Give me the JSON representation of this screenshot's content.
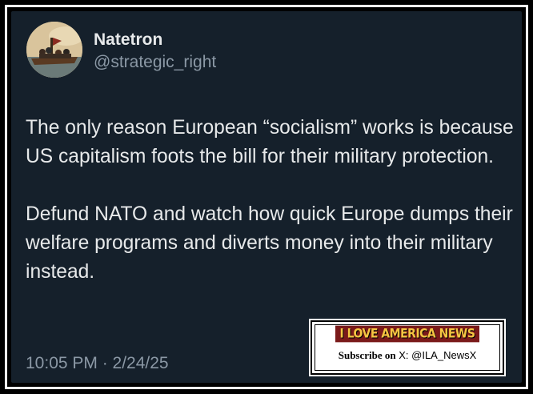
{
  "tweet": {
    "author": {
      "display_name": "Natetron",
      "handle": "@strategic_right",
      "avatar": "avatar-painting"
    },
    "paragraphs": [
      "The only reason European “socialism” works is because US capitalism foots the bill for their military protection.",
      "Defund NATO and watch how quick Europe dumps their welfare programs and diverts money into their military instead."
    ],
    "timestamp": "10:05 PM · 2/24/25"
  },
  "watermark": {
    "logo_text": "I LOVE AMERICA NEWS",
    "subscribe_label": "Subscribe on",
    "account": "X: @ILA_NewsX"
  },
  "colors": {
    "card_background": "#15202b",
    "primary_text": "#e7e9ea",
    "secondary_text": "#8b98a5",
    "frame": "#ffffff"
  }
}
